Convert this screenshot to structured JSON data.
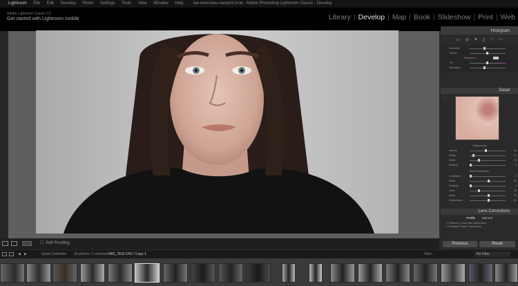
{
  "mac_menu": {
    "items": [
      "Lightroom",
      "File",
      "Edit",
      "Develop",
      "Photo",
      "Settings",
      "Tools",
      "View",
      "Window",
      "Help"
    ],
    "window_title": "lee-exercises-varanini.lrcat - Adobe Photoshop Lightroom Classic - Develop"
  },
  "identity_plate": {
    "line1": "Adobe Lightroom Classic CC",
    "line2": "Get started with Lightroom mobile"
  },
  "modules": [
    {
      "label": "Library",
      "active": false
    },
    {
      "label": "Develop",
      "active": true
    },
    {
      "label": "Map",
      "active": false
    },
    {
      "label": "Book",
      "active": false
    },
    {
      "label": "Slideshow",
      "active": false
    },
    {
      "label": "Print",
      "active": false
    },
    {
      "label": "Web",
      "active": false
    }
  ],
  "panels": {
    "histogram": "Histogram",
    "detail": "Detail",
    "lens_corrections": "Lens Corrections",
    "lens_tabs": [
      "Profile",
      "Manual"
    ],
    "lens_options": [
      "Remove Chromatic Aberration",
      "Enable Profile Corrections"
    ],
    "sharpening_title": "Sharpening",
    "noise_title": "Noise Reduction"
  },
  "basic_sliders": [
    {
      "label": "Saturation",
      "value": "0"
    },
    {
      "label": "Texture",
      "value": "0"
    },
    {
      "label": "Sharpness",
      "value": "0"
    },
    {
      "label": "Tint",
      "value": "0"
    },
    {
      "label": "Saturation",
      "value": "0"
    }
  ],
  "sharpening_sliders": [
    {
      "label": "Amount",
      "value": "40"
    },
    {
      "label": "Radius",
      "value": "1.0"
    },
    {
      "label": "Detail",
      "value": "25"
    },
    {
      "label": "Masking",
      "value": "0"
    }
  ],
  "noise_sliders": [
    {
      "label": "Luminance",
      "value": "0"
    },
    {
      "label": "Detail",
      "value": "50"
    },
    {
      "label": "Contrast",
      "value": "0"
    },
    {
      "label": "Color",
      "value": "25"
    },
    {
      "label": "Detail",
      "value": "50"
    },
    {
      "label": "Smoothness",
      "value": "50"
    }
  ],
  "buttons": {
    "previous": "Previous",
    "reset": "Reset"
  },
  "toolbar": {
    "soft_proofing": "Soft Proofing"
  },
  "filmstrip_bar": {
    "collection": "Quick Collection",
    "count": "34 photos / 1 selected",
    "filename": "IMG_7815.CR2 / Copy 1",
    "filter_label": "Filter :",
    "filter_value": "No Filter"
  },
  "colors": {
    "accent": "#e6e6e6",
    "panel_header": "#3a3a3a",
    "background": "#2b2b2b"
  }
}
